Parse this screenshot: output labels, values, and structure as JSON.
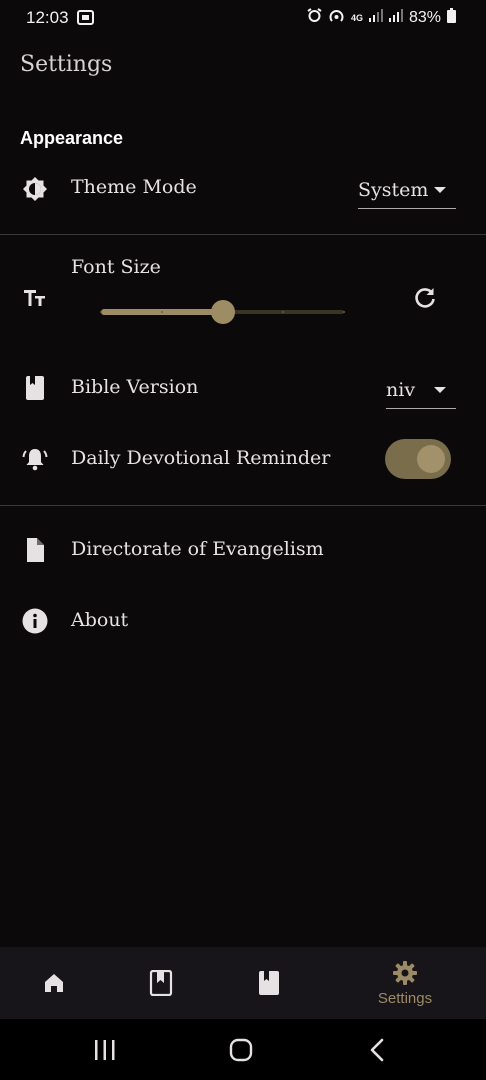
{
  "status_bar": {
    "time": "12:03",
    "network": "4G",
    "battery": "83%"
  },
  "header": {
    "title": "Settings"
  },
  "appearance": {
    "section_title": "Appearance",
    "theme_mode": {
      "label": "Theme Mode",
      "value": "System"
    },
    "font_size": {
      "label": "Font Size",
      "slider_fraction": 0.5,
      "steps": 4
    },
    "bible_version": {
      "label": "Bible Version",
      "value": "niv"
    },
    "daily_reminder": {
      "label": "Daily Devotional Reminder",
      "enabled": true
    }
  },
  "links": [
    {
      "label": "Directorate of Evangelism",
      "icon": "document-icon"
    },
    {
      "label": "About",
      "icon": "info-icon"
    }
  ],
  "bottom_nav": {
    "items": [
      {
        "icon": "home-icon",
        "label": ""
      },
      {
        "icon": "bookmark-book-icon",
        "label": ""
      },
      {
        "icon": "book-icon",
        "label": ""
      },
      {
        "icon": "gear-icon",
        "label": "Settings",
        "active": true
      }
    ]
  },
  "colors": {
    "background": "#0b090a",
    "accent": "#9d8c64",
    "nav_background": "#17151a"
  }
}
